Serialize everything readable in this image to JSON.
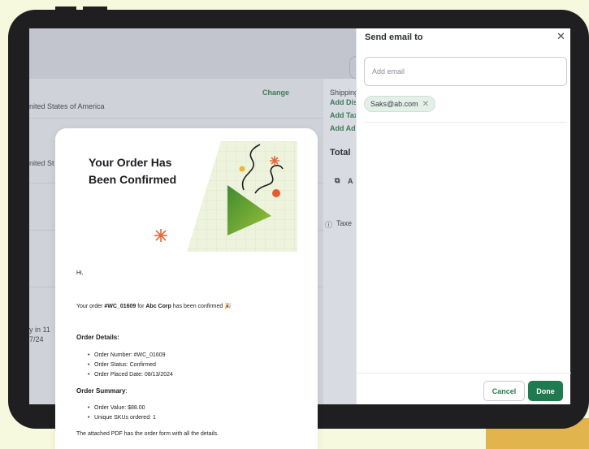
{
  "background_screen": {
    "change_link": "Change",
    "country_1": "nited States of America",
    "country_2": "nited St",
    "shipping_label": "Shipping",
    "add_dis": "Add Dis",
    "add_ta": "Add Tax",
    "add_ad": "Add Ad",
    "total_label": "Total",
    "taxes_text": "Taxe",
    "attach_text": "A",
    "left_line_1": "y in 11",
    "left_line_2": "7/24"
  },
  "drawer": {
    "title": "Send email to",
    "email_placeholder": "Add email",
    "recipients": [
      "Saks@ab.com"
    ],
    "cancel_label": "Cancel",
    "done_label": "Done"
  },
  "email_preview": {
    "hero_title_line1": "Your Order Has",
    "hero_title_line2": "Been Confirmed",
    "greeting": "Hi,",
    "intro_prefix": "Your order ",
    "order_id": "#WC_01609",
    "intro_mid": " for ",
    "company": "Abc Corp",
    "intro_suffix": " has been confirmed 🎉",
    "details_title": "Order Details:",
    "details_items": [
      "Order Number: #WC_01609",
      "Order Status: Confirmed",
      "Order Placed Date: 08/13/2024"
    ],
    "summary_title": "Order Summary",
    "summary_colon": ":",
    "summary_items": [
      "Order Value: $88.00",
      "Unique SKUs ordered: 1"
    ],
    "footer_text": "The attached PDF has the order form with all the details."
  },
  "colors": {
    "accent_green": "#1f7a4f",
    "chip_bg": "#e4efe8",
    "page_bg": "#f7f9df",
    "device": "#1f1f21"
  }
}
